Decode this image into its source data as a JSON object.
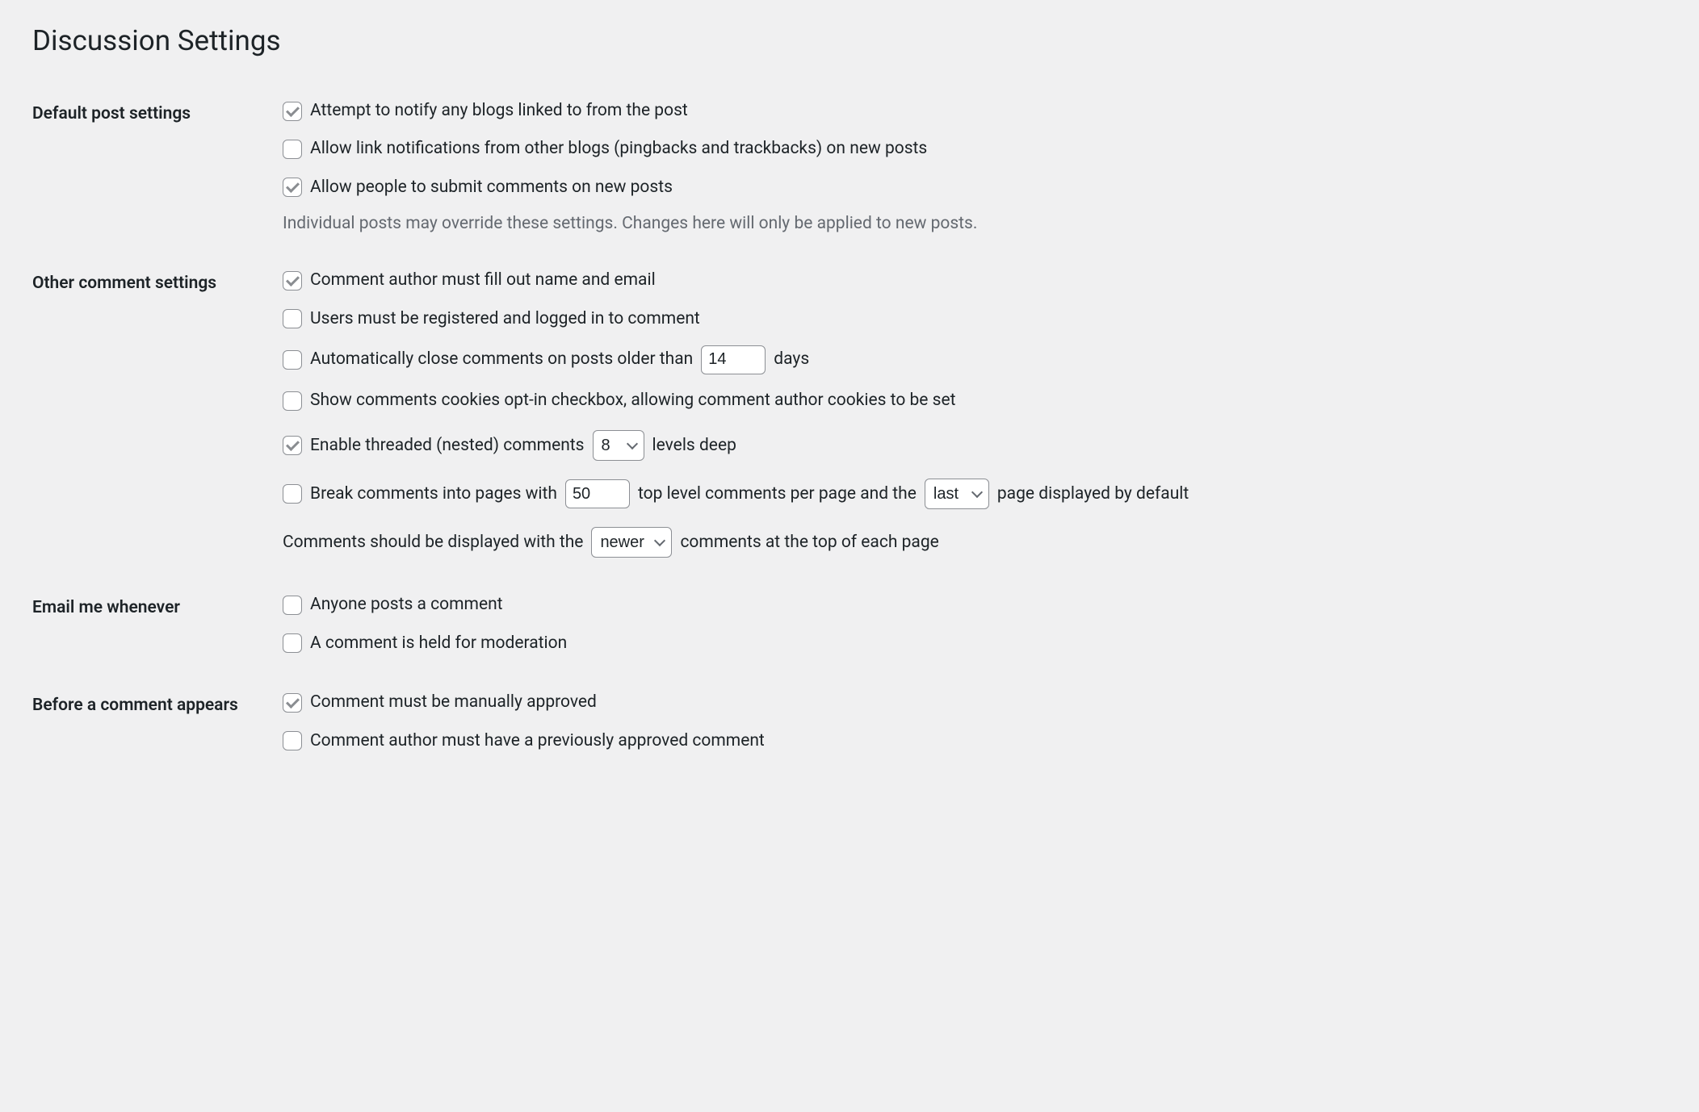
{
  "page_title": "Discussion Settings",
  "sections": {
    "default_post": {
      "heading": "Default post settings",
      "notify_linked": {
        "label": "Attempt to notify any blogs linked to from the post",
        "checked": true
      },
      "allow_pingbacks": {
        "label": "Allow link notifications from other blogs (pingbacks and trackbacks) on new posts",
        "checked": false
      },
      "allow_comments": {
        "label": "Allow people to submit comments on new posts",
        "checked": true
      },
      "description": "Individual posts may override these settings. Changes here will only be applied to new posts."
    },
    "other_comment": {
      "heading": "Other comment settings",
      "require_name_email": {
        "label": "Comment author must fill out name and email",
        "checked": true
      },
      "require_registration": {
        "label": "Users must be registered and logged in to comment",
        "checked": false
      },
      "auto_close": {
        "checked": false,
        "label_before": "Automatically close comments on posts older than",
        "days_value": "14",
        "label_after": "days"
      },
      "cookies_optin": {
        "label": "Show comments cookies opt-in checkbox, allowing comment author cookies to be set",
        "checked": false
      },
      "threaded": {
        "checked": true,
        "label_before": "Enable threaded (nested) comments",
        "depth_value": "8",
        "label_after": "levels deep"
      },
      "paginate": {
        "checked": false,
        "label1": "Break comments into pages with",
        "per_page_value": "50",
        "label2": "top level comments per page and the",
        "default_page_value": "last",
        "label3": "page displayed by default"
      },
      "order": {
        "label1": "Comments should be displayed with the",
        "order_value": "newer",
        "label2": "comments at the top of each page"
      }
    },
    "email_me": {
      "heading": "Email me whenever",
      "anyone_posts": {
        "label": "Anyone posts a comment",
        "checked": false
      },
      "held_moderation": {
        "label": "A comment is held for moderation",
        "checked": false
      }
    },
    "before_appears": {
      "heading": "Before a comment appears",
      "manual_approve": {
        "label": "Comment must be manually approved",
        "checked": true
      },
      "prev_approved": {
        "label": "Comment author must have a previously approved comment",
        "checked": false
      }
    }
  }
}
